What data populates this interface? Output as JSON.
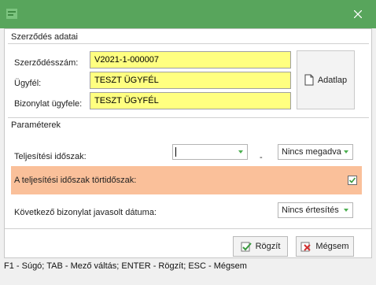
{
  "window": {
    "close_glyph": "✕"
  },
  "contract_section": {
    "title": "Szerződés adatai",
    "contract_number_label": "Szerződésszám:",
    "contract_number_value": "V2021-1-000007",
    "customer_label": "Ügyfél:",
    "customer_value": "TESZT ÜGYFÉL",
    "receipt_customer_label": "Bizonylat ügyfele:",
    "receipt_customer_value": "TESZT ÜGYFÉL",
    "datasheet_button_label": "Adatlap"
  },
  "parameters_section": {
    "title": "Paraméterek",
    "fulfillment_period_label": "Teljesítési időszak:",
    "fulfillment_period_from_value": "",
    "range_separator": "-",
    "fulfillment_period_to_value": "Nincs megadva",
    "historical_period_label": "A teljesítési időszak törtidőszak:",
    "historical_period_checked": true,
    "next_receipt_date_label": "Következő bizonylat javasolt dátuma:",
    "next_receipt_date_value": "Nincs értesítés"
  },
  "actions": {
    "save_label": "Rögzít",
    "cancel_label": "Mégsem"
  },
  "statusbar": {
    "hint": "F1 - Súgó; TAB - Mező váltás; ENTER - Rögzít; ESC - Mégsem"
  },
  "colors": {
    "titlebar": "#58a55c",
    "required_field": "#ffff80",
    "highlight_row": "#fac09a",
    "accent": "#4caf50"
  }
}
